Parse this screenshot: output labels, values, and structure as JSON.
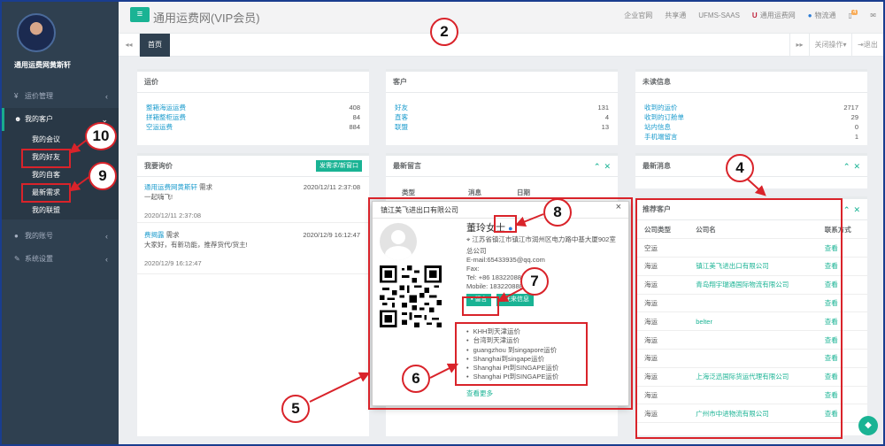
{
  "profile": {
    "name": "通用运费网黄斯轩"
  },
  "sidebar": {
    "items": [
      {
        "label": "运价管理",
        "icon": "yen-icon"
      },
      {
        "label": "我的客户",
        "icon": "users-icon"
      },
      {
        "label": "我的账号",
        "icon": "user-icon"
      },
      {
        "label": "系统设置",
        "icon": "wrench-icon"
      }
    ],
    "sub": [
      "我的会议",
      "我的好友",
      "我的自客",
      "最新需求",
      "我的联盟"
    ]
  },
  "header": {
    "title": "通用运费网(VIP会员)",
    "links": [
      "企业官网",
      "共享通",
      "UFMS-SAAS",
      "通用运费网",
      "物流通"
    ],
    "badge": "4"
  },
  "tabs": {
    "home": "首页",
    "close_ops": "关闭操作▾",
    "exit": "退出"
  },
  "freight": {
    "title": "运价",
    "rows": [
      [
        "整箱海运运费",
        "408"
      ],
      [
        "拼箱整柜运费",
        "84"
      ],
      [
        "空运运费",
        "884"
      ]
    ]
  },
  "customers": {
    "title": "客户",
    "rows": [
      [
        "好友",
        "131"
      ],
      [
        "直客",
        "4"
      ],
      [
        "联盟",
        "13"
      ]
    ]
  },
  "unread": {
    "title": "未读信息",
    "rows": [
      [
        "收到的运价",
        "2717"
      ],
      [
        "收到的订舱单",
        "29"
      ],
      [
        "站内信息",
        "0"
      ],
      [
        "手机端留言",
        "1"
      ]
    ]
  },
  "inquiries": {
    "title": "我要询价",
    "button": "发需求/新窗口",
    "items": [
      {
        "author": "通用运费网黄斯轩",
        "action": "需求",
        "date": "2020/12/11 2:37:08",
        "text": "一起嗨飞!",
        "time": "2020/12/11 2:37:08"
      },
      {
        "author": "费揭露",
        "action": "需求",
        "date": "2020/12/9 16:12:47",
        "text": "大家好，有新功能，推荐货代/货主!",
        "time": "2020/12/9 16:12:47"
      }
    ]
  },
  "latest_msg": {
    "title": "最新留言",
    "cols": [
      "类型",
      "消息",
      "日期"
    ]
  },
  "latest_news": {
    "title": "最新消息"
  },
  "recommended": {
    "title": "推荐客户",
    "cols": [
      "公司类型",
      "公司名",
      "联系方式"
    ],
    "rows": [
      [
        "空运",
        "",
        "查看"
      ],
      [
        "海运",
        "镇江美飞进出口有限公司",
        "查看"
      ],
      [
        "海运",
        "青岛翔宇瑞通国际物流有限公司",
        "查看"
      ],
      [
        "海运",
        "",
        "查看"
      ],
      [
        "海运",
        "belter",
        "查看"
      ],
      [
        "海运",
        "",
        "查看"
      ],
      [
        "海运",
        "",
        "查看"
      ],
      [
        "海运",
        "上海泛迅国际货运代理有限公司",
        "查看"
      ],
      [
        "海运",
        "",
        "查看"
      ],
      [
        "海运",
        "广州市中进物流有限公司",
        "查看"
      ]
    ]
  },
  "modal": {
    "company": "镇江美飞进出口有限公司",
    "name": "董玲女士",
    "address": "江苏省镇江市镇江市润州区电力路中基大厦902室",
    "role": "总公司",
    "email": "E-mail:65433935@qq.com",
    "fax": "Fax:",
    "tel": "Tel: +86 18322088869",
    "mobile": "Mobile: 18322088869",
    "btn_msg": "留言",
    "btn_history": "往来信息",
    "routes": [
      "KHH到天津运价",
      "台湾到天津运价",
      "guangzhou 到singapore运价",
      "Shanghai到singape运价",
      "Shanghai Pt到SINGAPE运价",
      "Shanghai Pt到SINGAPE运价"
    ],
    "more": "查看更多"
  },
  "annotations": [
    "2",
    "4",
    "5",
    "6",
    "7",
    "8",
    "9",
    "10"
  ],
  "colors": {
    "accent": "#1ab394",
    "sidebar": "#2f4050",
    "annotation": "#d9232a"
  }
}
